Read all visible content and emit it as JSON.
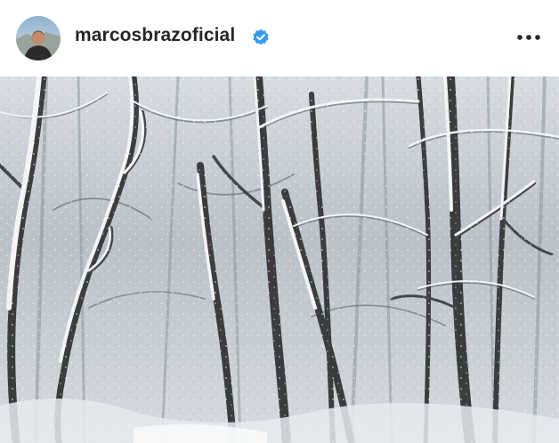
{
  "post": {
    "username": "marcosbrazoficial",
    "verified": true,
    "avatar_icon": "profile-photo",
    "verified_icon": "verified-badge-icon",
    "more_icon": "more-options-icon",
    "image_description_icon": "snowy-forest-photo"
  },
  "colors": {
    "verified_blue": "#3897f0",
    "username_text": "#262626",
    "snow": "#eef1f4",
    "bark": "#3a3c40"
  }
}
